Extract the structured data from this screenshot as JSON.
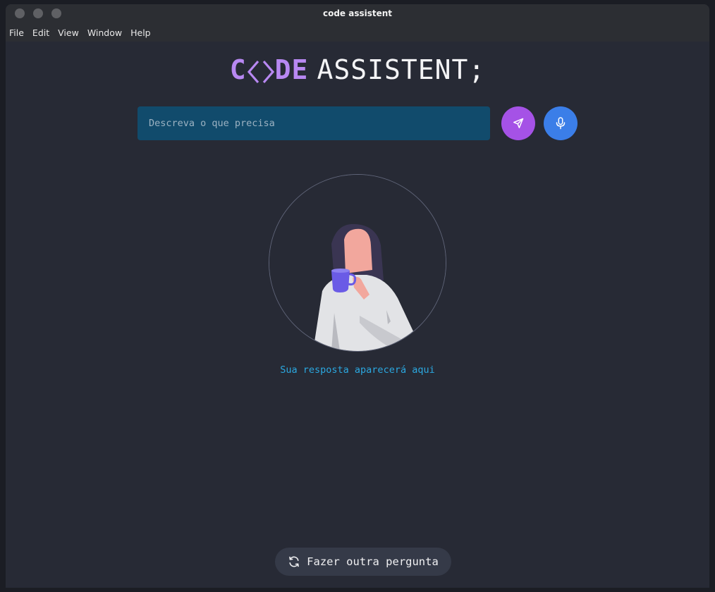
{
  "window": {
    "title": "code assistent"
  },
  "menu": [
    "File",
    "Edit",
    "View",
    "Window",
    "Help"
  ],
  "logo": {
    "code_start": "C",
    "code_end": "DE",
    "rest": "ASSISTENT;"
  },
  "search": {
    "placeholder": "Descreva o que precisa",
    "value": ""
  },
  "buttons": {
    "send_icon": "send-icon",
    "mic_icon": "microphone-icon",
    "reset_label": "Fazer outra pergunta",
    "reset_icon": "refresh-icon"
  },
  "answer": {
    "placeholder": "Sua resposta aparecerá aqui"
  },
  "colors": {
    "accent_purple": "#a552e6",
    "accent_blue": "#3b7ee8",
    "logo_purple": "#b888f2",
    "input_bg": "#114b6c",
    "answer_text": "#2ba8e0",
    "bg": "#272a35"
  }
}
